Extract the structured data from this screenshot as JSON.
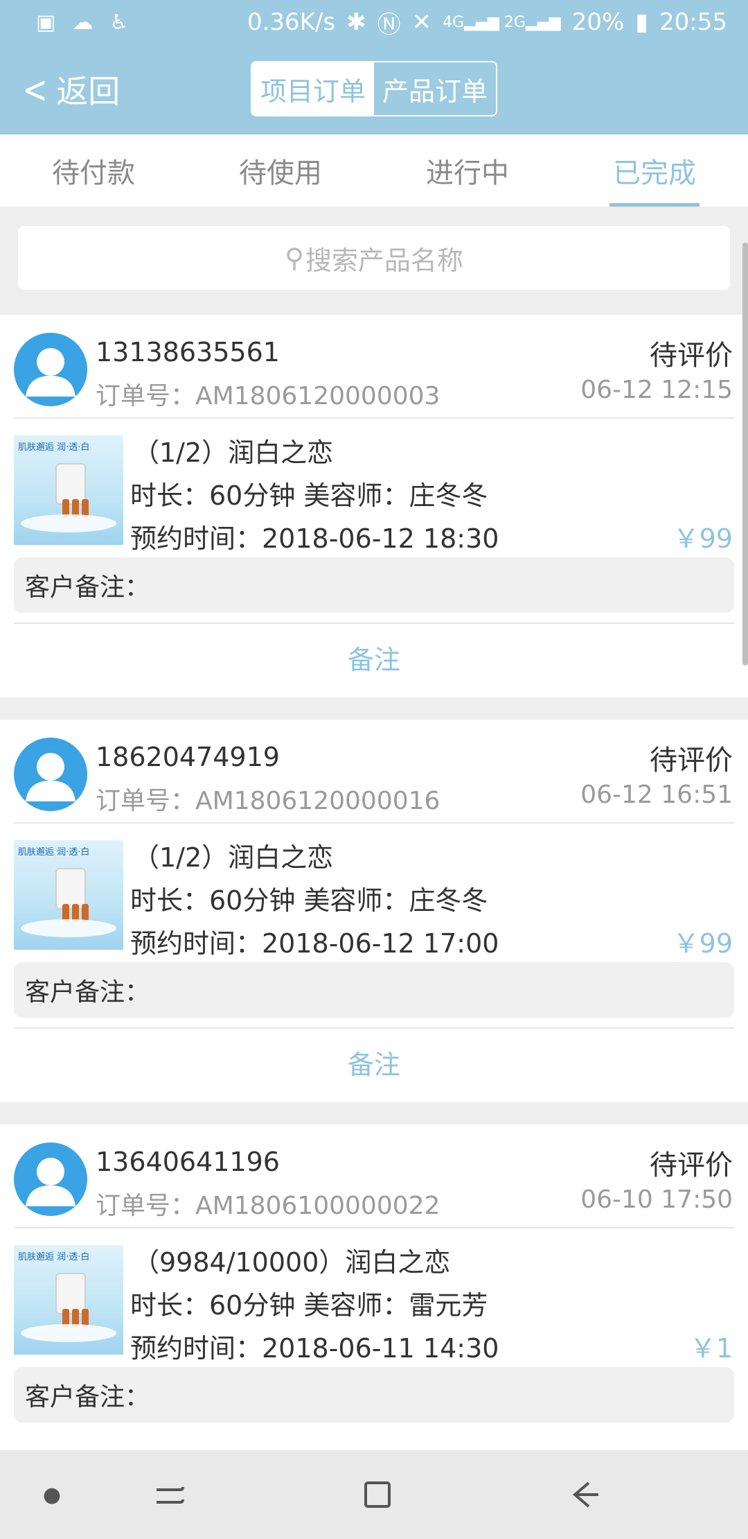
{
  "status_bar": {
    "speed": "0.36K/s",
    "battery": "20%",
    "time": "20:55",
    "left_icons": [
      "image-icon",
      "cloud-icon",
      "accessibility-icon"
    ],
    "right_icons": [
      "bluetooth-icon",
      "nfc-icon",
      "mute-icon",
      "signal-icon",
      "battery-icon"
    ]
  },
  "header": {
    "back_label": "返回",
    "segments": [
      "项目订单",
      "产品订单"
    ],
    "active_segment": "项目订单"
  },
  "tabs": {
    "items": [
      "待付款",
      "待使用",
      "进行中",
      "已完成"
    ],
    "active": "已完成"
  },
  "search": {
    "placeholder": "搜索产品名称"
  },
  "orders": [
    {
      "phone": "13138635561",
      "order_no": "订单号：AM1806120000003",
      "status": "待评价",
      "time": "06-12 12:15",
      "product": "（1/2）润白之恋",
      "info": "时长：60分钟   美容师：庄冬冬",
      "appointment": "预约时间：2018-06-12 18:30",
      "price": "￥99",
      "remark": "客户备注：",
      "note_button": "备注"
    },
    {
      "phone": "18620474919",
      "order_no": "订单号：AM1806120000016",
      "status": "待评价",
      "time": "06-12 16:51",
      "product": "（1/2）润白之恋",
      "info": "时长：60分钟   美容师：庄冬冬",
      "appointment": "预约时间：2018-06-12 17:00",
      "price": "￥99",
      "remark": "客户备注：",
      "note_button": "备注"
    },
    {
      "phone": "13640641196",
      "order_no": "订单号：AM1806100000022",
      "status": "待评价",
      "time": "06-10 17:50",
      "product": "（9984/10000）润白之恋",
      "info": "时长：60分钟   美容师：雷元芳",
      "appointment": "预约时间：2018-06-11 14:30",
      "price": "￥1",
      "remark": "客户备注：",
      "note_button": "备注"
    }
  ],
  "thumbnail_banner": "肌肤邂逅 润·透·白",
  "colors": {
    "header_bg": "#9ccbe2",
    "accent": "#8ec4df",
    "avatar": "#3aa3e3"
  },
  "nav_bar": {
    "icons": [
      "dot-icon",
      "recent-apps-icon",
      "home-icon",
      "back-icon"
    ]
  }
}
